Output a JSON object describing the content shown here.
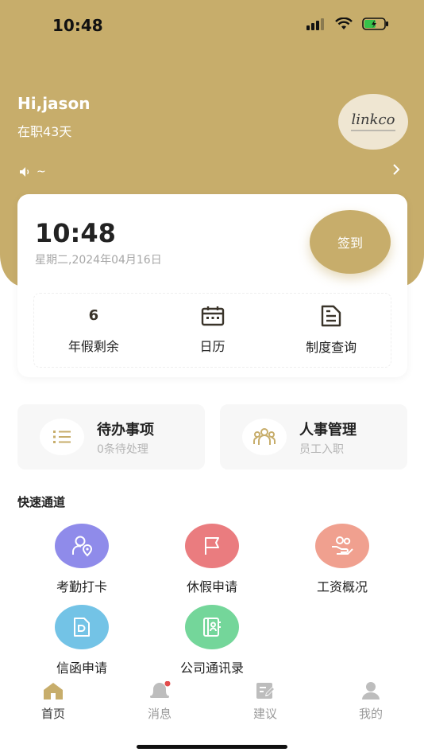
{
  "status": {
    "time": "10:48"
  },
  "header": {
    "greeting": "Hi,jason",
    "tenure": "在职43天",
    "logo_text": "linkco",
    "notice_text": "~"
  },
  "clock": {
    "time": "10:48",
    "date": "星期二,2024年04月16日",
    "checkin_label": "签到"
  },
  "shortcuts": [
    {
      "value": "6",
      "label": "年假剩余",
      "icon": "number"
    },
    {
      "value": "",
      "label": "日历",
      "icon": "calendar-icon"
    },
    {
      "value": "",
      "label": "制度查询",
      "icon": "document-icon"
    }
  ],
  "tiles": [
    {
      "title": "待办事项",
      "subtitle": "0条待处理",
      "icon": "list-icon"
    },
    {
      "title": "人事管理",
      "subtitle": "员工入职",
      "icon": "people-icon"
    }
  ],
  "quick": {
    "title": "快速通道",
    "items": [
      {
        "label": "考勤打卡",
        "icon": "user-location-icon",
        "color": "#8f8bea"
      },
      {
        "label": "休假申请",
        "icon": "flag-icon",
        "color": "#ea7c7f"
      },
      {
        "label": "工资概况",
        "icon": "hand-money-icon",
        "color": "#f0a08f"
      },
      {
        "label": "信函申请",
        "icon": "letter-icon",
        "color": "#73c3e6"
      },
      {
        "label": "公司通讯录",
        "icon": "contacts-icon",
        "color": "#74d69a"
      }
    ]
  },
  "tabbar": {
    "items": [
      {
        "label": "首页",
        "icon": "home-icon",
        "active": true
      },
      {
        "label": "消息",
        "icon": "bell-icon",
        "active": false
      },
      {
        "label": "建议",
        "icon": "edit-icon",
        "active": false
      },
      {
        "label": "我的",
        "icon": "profile-icon",
        "active": false
      }
    ]
  },
  "colors": {
    "brand": "#c7ad6b",
    "badge": "#e24b4b"
  }
}
